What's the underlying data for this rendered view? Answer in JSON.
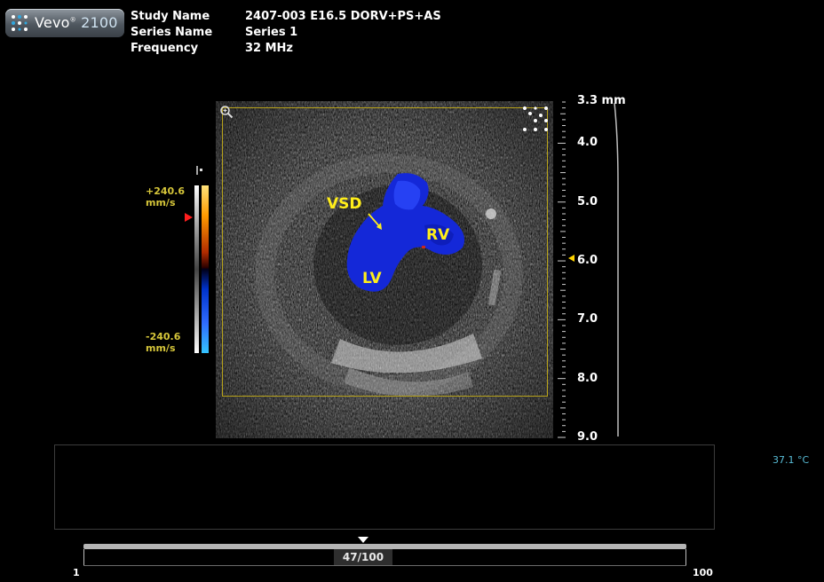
{
  "logo": {
    "brand": "Vevo",
    "model": "2100",
    "mark": "®"
  },
  "header": {
    "study_name_label": "Study Name",
    "study_name_value": "2407-003 E16.5 DORV+PS+AS",
    "series_name_label": "Series Name",
    "series_name_value": "Series 1",
    "frequency_label": "Frequency",
    "frequency_value": "32 MHz"
  },
  "annotations": {
    "vsd": "VSD",
    "rv": "RV",
    "lv": "LV"
  },
  "color_scale": {
    "max_value": "+240.6",
    "max_unit": "mm/s",
    "min_value": "-240.6",
    "min_unit": "mm/s"
  },
  "depth_scale": {
    "labels": [
      "3.3 mm",
      "4.0",
      "5.0",
      "6.0",
      "7.0",
      "8.0",
      "9.0"
    ],
    "focus_depth_mm": 5.95
  },
  "temperature": "37.1 °C",
  "frames": {
    "current_label": "47/100",
    "min": "1",
    "max": "100",
    "current": 47,
    "total": 100
  },
  "colors": {
    "annotation": "#ffee1a",
    "roi_box": "#b8a31a",
    "velocity_text": "#d6c63a",
    "temperature": "#58bcd6",
    "doppler_blue": "#1428d8"
  },
  "icons": {
    "zoom": "magnifier-plus-icon",
    "probe": "transducer-dots-icon",
    "logo": "vevo-logo-icon"
  }
}
